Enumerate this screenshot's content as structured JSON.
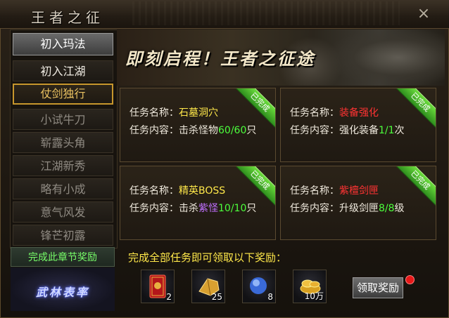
{
  "window": {
    "title": "王者之征",
    "close_label": "×"
  },
  "sidebar": {
    "tabs": [
      {
        "label": "初入玛法",
        "state": "top"
      },
      {
        "label": "初入江湖",
        "state": "done"
      },
      {
        "label": "仗剑独行",
        "state": "active"
      },
      {
        "label": "小试牛刀",
        "state": "locked"
      },
      {
        "label": "崭露头角",
        "state": "locked"
      },
      {
        "label": "江湖新秀",
        "state": "locked"
      },
      {
        "label": "略有小成",
        "state": "locked"
      },
      {
        "label": "意气风发",
        "state": "locked"
      },
      {
        "label": "锋芒初露",
        "state": "locked"
      }
    ],
    "chapter_reward_label": "完成此章节奖励",
    "badge_text": "武林表率"
  },
  "banner": {
    "slogan": "即刻启程！王者之征途"
  },
  "tasks": [
    {
      "name_label": "任务名称：",
      "name": "石墓洞穴",
      "name_color": "#ffe84a",
      "content_label": "任务内容：",
      "content_prefix": "击杀怪物",
      "target": "",
      "progress": "60/60",
      "unit": "只",
      "badge": "已完成"
    },
    {
      "name_label": "任务名称：",
      "name": "装备强化",
      "name_color": "#ff3333",
      "content_label": "任务内容：",
      "content_prefix": "强化装备",
      "target": "",
      "progress": "1/1",
      "unit": "次",
      "badge": "已完成"
    },
    {
      "name_label": "任务名称：",
      "name": "精英BOSS",
      "name_color": "#ffe84a",
      "content_label": "任务内容：",
      "content_prefix": "击杀",
      "target": "紫怪",
      "progress": "10/10",
      "unit": "只",
      "badge": "已完成"
    },
    {
      "name_label": "任务名称：",
      "name": "紫檀剑匣",
      "name_color": "#ff3333",
      "content_label": "任务内容：",
      "content_prefix": "升级剑匣",
      "target": "",
      "progress": "8/8",
      "unit": "级",
      "badge": "已完成"
    }
  ],
  "reward": {
    "title": "完成全部任务即可领取以下奖励：",
    "items": [
      {
        "icon": "red-scroll-icon",
        "count": "2"
      },
      {
        "icon": "gold-ore-icon",
        "count": "25"
      },
      {
        "icon": "blue-orb-icon",
        "count": "8"
      },
      {
        "icon": "gold-ingot-icon",
        "count": "10万"
      }
    ],
    "claim_label": "领取奖励"
  },
  "colors": {
    "accent_gold": "#c7962c",
    "complete_green": "#4cff3c",
    "name_yellow": "#ffe84a",
    "name_red": "#ff3333"
  }
}
